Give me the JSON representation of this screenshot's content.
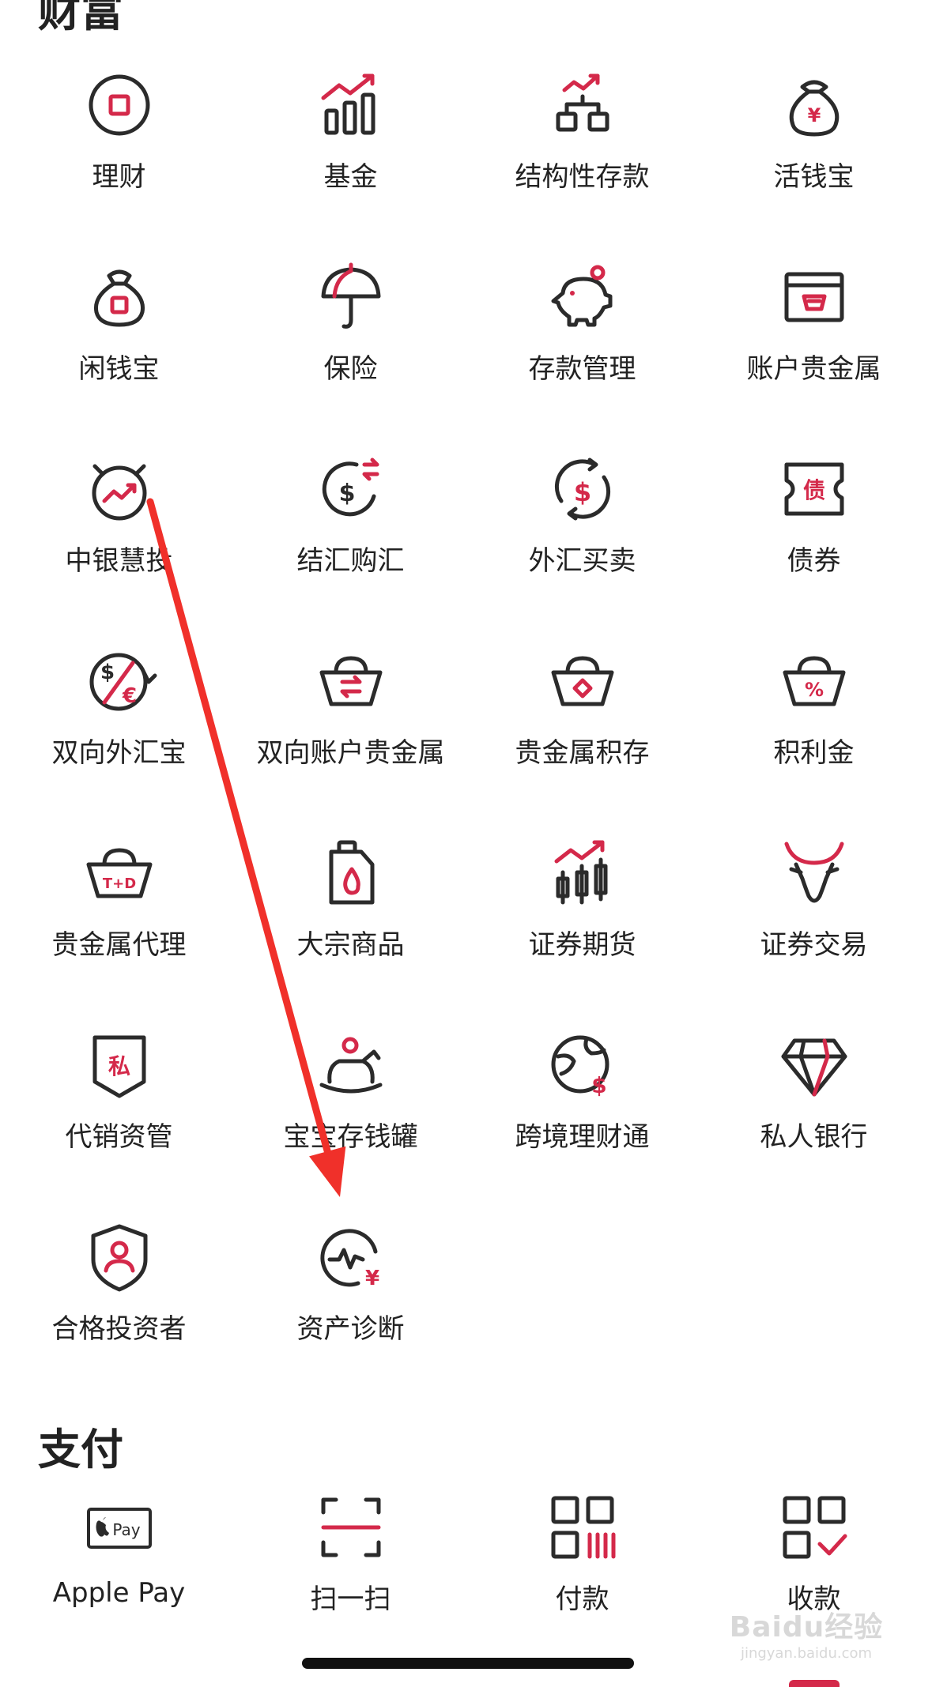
{
  "wealth": {
    "title": "财富",
    "items": [
      {
        "label": "理财",
        "icon": "coin-square-icon"
      },
      {
        "label": "基金",
        "icon": "bar-trend-icon"
      },
      {
        "label": "结构性存款",
        "icon": "structure-trend-icon"
      },
      {
        "label": "活钱宝",
        "icon": "money-bag-yen-icon"
      },
      {
        "label": "闲钱宝",
        "icon": "money-bag-square-icon"
      },
      {
        "label": "保险",
        "icon": "umbrella-icon"
      },
      {
        "label": "存款管理",
        "icon": "piggy-bank-icon"
      },
      {
        "label": "账户贵金属",
        "icon": "gold-card-icon"
      },
      {
        "label": "中银慧投",
        "icon": "alarm-trend-icon"
      },
      {
        "label": "结汇购汇",
        "icon": "dollar-exchange-icon"
      },
      {
        "label": "外汇买卖",
        "icon": "dollar-cycle-icon"
      },
      {
        "label": "债券",
        "icon": "bond-ticket-icon",
        "glyph": "债"
      },
      {
        "label": "双向外汇宝",
        "icon": "dollar-euro-icon"
      },
      {
        "label": "双向账户贵金属",
        "icon": "ingot-exchange-icon"
      },
      {
        "label": "贵金属积存",
        "icon": "ingot-diamond-icon"
      },
      {
        "label": "积利金",
        "icon": "ingot-percent-icon",
        "glyph": "%"
      },
      {
        "label": "贵金属代理",
        "icon": "ingot-tplusd-icon",
        "glyph": "T+D"
      },
      {
        "label": "大宗商品",
        "icon": "oil-can-icon"
      },
      {
        "label": "证券期货",
        "icon": "candlestick-icon"
      },
      {
        "label": "证券交易",
        "icon": "bull-icon"
      },
      {
        "label": "代销资管",
        "icon": "private-shield-icon",
        "glyph": "私"
      },
      {
        "label": "宝宝存钱罐",
        "icon": "rocking-horse-icon"
      },
      {
        "label": "跨境理财通",
        "icon": "globe-dollar-icon"
      },
      {
        "label": "私人银行",
        "icon": "diamond-icon"
      },
      {
        "label": "合格投资者",
        "icon": "shield-user-icon"
      },
      {
        "label": "资产诊断",
        "icon": "pulse-yen-icon"
      }
    ]
  },
  "payment": {
    "title": "支付",
    "items": [
      {
        "label": "Apple Pay",
        "icon": "apple-pay-icon",
        "glyph": "Pay"
      },
      {
        "label": "扫一扫",
        "icon": "scan-icon"
      },
      {
        "label": "付款",
        "icon": "pay-code-icon"
      },
      {
        "label": "收款",
        "icon": "receive-code-icon"
      }
    ]
  },
  "watermark": {
    "main": "Baidu经验",
    "sub": "jingyan.baidu.com"
  },
  "colors": {
    "accent": "#d4294a",
    "ink": "#2b2b2b",
    "annotation_arrow": "#f0302a"
  }
}
